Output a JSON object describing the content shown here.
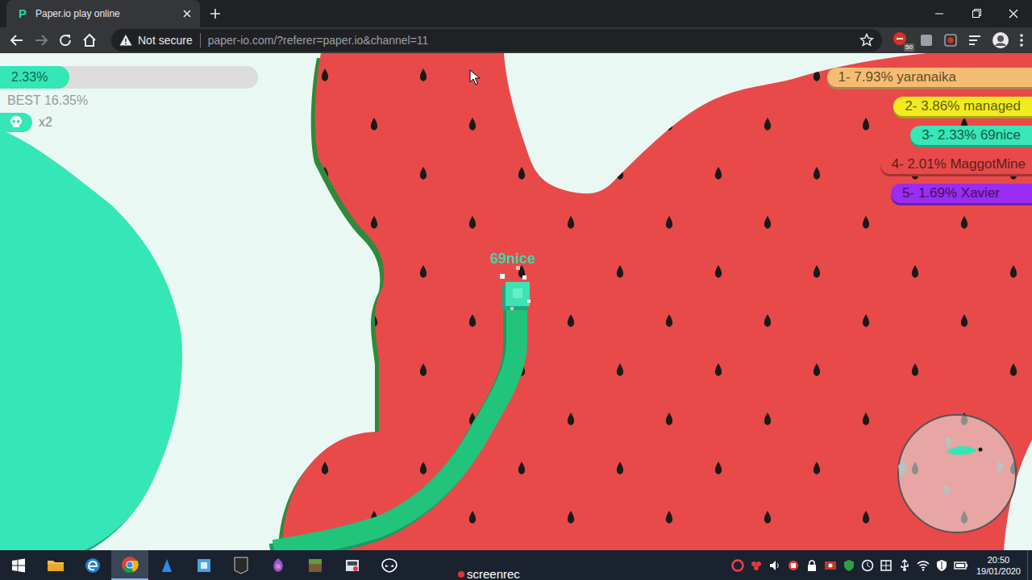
{
  "browser": {
    "favicon": "P",
    "tab": {
      "title": "Paper.io play online",
      "selected": true
    },
    "address": {
      "security": "Not secure",
      "url": "paper-io.com/?referer=paper.io&channel=11"
    },
    "extension_badge": "50"
  },
  "hud": {
    "percent": "2.33%",
    "level": 0.27,
    "best": "BEST 16.35%",
    "kills": "x2"
  },
  "player": {
    "name": "69nice"
  },
  "leaderboard": [
    {
      "label": "1- 7.93% yaranaika",
      "color": "#f6bd72"
    },
    {
      "label": "2- 3.86% managed",
      "color": "#f2ec1e"
    },
    {
      "label": "3- 2.33% 69nice",
      "color": "#38e6b6"
    },
    {
      "label": "4- 2.01% MaggotMine",
      "color": "#e84a4a"
    },
    {
      "label": "5- 1.69% Xavier",
      "color": "#9b2cf2"
    }
  ],
  "taskbar": {
    "watermark": "screenrec",
    "time": "20:50",
    "date": "19/01/2020"
  }
}
